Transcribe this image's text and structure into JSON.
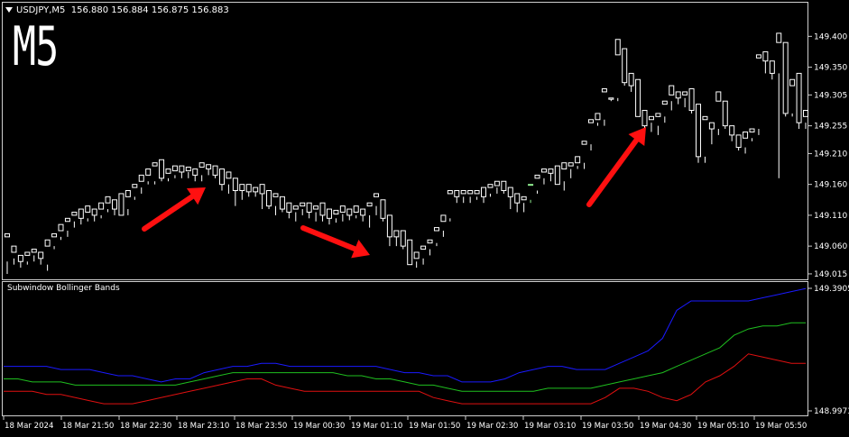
{
  "header": {
    "symbol": "USDJPY,M5",
    "ohlc": "156.880 156.884 156.875 156.883"
  },
  "timeframe_label": "M5",
  "subwindow": {
    "title": "Subwindow Bollinger Bands",
    "scale_top": "149.3905",
    "scale_bottom": "148.9973"
  },
  "colors": {
    "bull": "#90ee90",
    "bear": "#ffffff",
    "upper": "#1a1aff",
    "middle": "#1fbf1f",
    "lower": "#e01010",
    "arrow": "#ff1010"
  },
  "chart_data": [
    {
      "type": "candlestick",
      "series": "USDJPY M5",
      "yticks": [
        "149.400",
        "149.350",
        "149.305",
        "149.255",
        "149.210",
        "149.160",
        "149.110",
        "149.060",
        "149.015"
      ],
      "ylim": [
        149.012,
        149.418
      ],
      "xticks": [
        "18 Mar 2024",
        "18 Mar 21:50",
        "18 Mar 22:30",
        "18 Mar 23:10",
        "18 Mar 23:50",
        "19 Mar 00:30",
        "19 Mar 01:10",
        "19 Mar 01:50",
        "19 Mar 02:30",
        "19 Mar 03:10",
        "19 Mar 03:50",
        "19 Mar 04:30",
        "19 Mar 05:10",
        "19 Mar 05:50"
      ],
      "candles": [
        [
          149.08,
          149.015,
          149.035,
          149.075
        ],
        [
          149.06,
          149.03,
          149.04,
          149.05
        ],
        [
          149.045,
          149.025,
          149.04,
          149.035
        ],
        [
          149.05,
          149.03,
          149.035,
          149.045
        ],
        [
          149.055,
          149.035,
          149.045,
          149.05
        ],
        [
          149.05,
          149.03,
          149.045,
          149.04
        ],
        [
          149.07,
          149.02,
          149.03,
          149.06
        ],
        [
          149.08,
          149.055,
          149.06,
          149.075
        ],
        [
          149.095,
          149.07,
          149.075,
          149.085
        ],
        [
          149.105,
          149.075,
          149.085,
          149.1
        ],
        [
          149.115,
          149.09,
          149.1,
          149.11
        ],
        [
          149.12,
          149.095,
          149.11,
          149.105
        ],
        [
          149.125,
          149.1,
          149.105,
          149.115
        ],
        [
          149.12,
          149.1,
          149.115,
          149.11
        ],
        [
          149.13,
          149.105,
          149.11,
          149.12
        ],
        [
          149.14,
          149.115,
          149.12,
          149.13
        ],
        [
          149.135,
          149.11,
          149.13,
          149.12
        ],
        [
          149.145,
          149.115,
          149.12,
          149.11
        ],
        [
          149.15,
          149.12,
          149.11,
          149.14
        ],
        [
          149.16,
          149.135,
          149.14,
          149.155
        ],
        [
          149.175,
          149.145,
          149.155,
          149.165
        ],
        [
          149.185,
          149.16,
          149.165,
          149.175
        ],
        [
          149.195,
          149.16,
          149.165,
          149.19
        ],
        [
          149.2,
          149.165,
          149.19,
          149.17
        ],
        [
          149.185,
          149.165,
          149.17,
          149.178
        ],
        [
          149.19,
          149.17,
          149.175,
          149.182
        ],
        [
          149.19,
          149.17,
          149.182,
          149.18
        ],
        [
          149.188,
          149.17,
          149.18,
          149.182
        ],
        [
          149.185,
          149.165,
          149.182,
          149.175
        ],
        [
          149.195,
          149.165,
          149.175,
          149.188
        ],
        [
          149.192,
          149.175,
          149.188,
          149.185
        ],
        [
          149.19,
          149.17,
          149.185,
          149.175
        ],
        [
          149.185,
          149.15,
          149.175,
          149.16
        ],
        [
          149.18,
          149.145,
          149.16,
          149.17
        ],
        [
          149.17,
          149.125,
          149.17,
          149.15
        ],
        [
          149.16,
          149.135,
          149.15,
          149.15
        ],
        [
          149.16,
          149.14,
          149.15,
          149.148
        ],
        [
          149.155,
          149.14,
          149.15,
          149.148
        ],
        [
          149.16,
          149.12,
          149.148,
          149.145
        ],
        [
          149.15,
          149.12,
          149.145,
          149.125
        ],
        [
          149.145,
          149.11,
          149.125,
          149.14
        ],
        [
          149.14,
          149.115,
          149.135,
          149.12
        ],
        [
          149.13,
          149.105,
          149.12,
          149.115
        ],
        [
          149.125,
          149.1,
          149.115,
          149.12
        ],
        [
          149.13,
          149.11,
          149.12,
          149.125
        ],
        [
          149.13,
          149.105,
          149.125,
          149.115
        ],
        [
          149.125,
          149.1,
          149.115,
          149.12
        ],
        [
          149.13,
          149.1,
          149.12,
          149.11
        ],
        [
          149.12,
          149.095,
          149.11,
          149.105
        ],
        [
          149.118,
          149.098,
          149.105,
          149.112
        ],
        [
          149.125,
          149.1,
          149.112,
          149.115
        ],
        [
          149.12,
          149.102,
          149.115,
          149.11
        ],
        [
          149.125,
          149.105,
          149.11,
          149.115
        ],
        [
          149.12,
          149.1,
          149.115,
          149.11
        ],
        [
          149.13,
          149.09,
          149.11,
          149.125
        ],
        [
          149.145,
          149.11,
          149.125,
          149.14
        ],
        [
          149.135,
          149.1,
          149.135,
          149.105
        ],
        [
          149.11,
          149.06,
          149.105,
          149.075
        ],
        [
          149.085,
          149.06,
          149.075,
          149.075
        ],
        [
          149.085,
          149.055,
          149.08,
          149.06
        ],
        [
          149.07,
          149.03,
          149.065,
          149.03
        ],
        [
          149.05,
          149.025,
          149.035,
          149.04
        ],
        [
          149.06,
          149.03,
          149.04,
          149.055
        ],
        [
          149.07,
          149.045,
          149.055,
          149.065
        ],
        [
          149.09,
          149.06,
          149.065,
          149.085
        ],
        [
          149.11,
          149.075,
          149.085,
          149.1
        ],
        [
          149.15,
          149.1,
          149.105,
          149.145
        ],
        [
          149.15,
          149.13,
          149.145,
          149.14
        ],
        [
          149.15,
          149.13,
          149.14,
          149.145
        ],
        [
          149.15,
          149.13,
          149.14,
          149.145
        ],
        [
          149.15,
          149.135,
          149.14,
          149.145
        ],
        [
          149.155,
          149.13,
          149.145,
          149.14
        ],
        [
          149.16,
          149.14,
          149.145,
          149.155
        ],
        [
          149.165,
          149.145,
          149.155,
          149.158
        ],
        [
          149.165,
          149.145,
          149.158,
          149.15
        ],
        [
          149.155,
          149.12,
          149.15,
          149.14
        ],
        [
          149.145,
          149.115,
          149.14,
          149.13
        ],
        [
          149.14,
          149.115,
          149.13,
          149.135
        ],
        [
          149.16,
          149.13,
          149.135,
          149.16
        ],
        [
          149.175,
          149.145,
          149.15,
          149.17
        ],
        [
          149.185,
          149.16,
          149.17,
          149.18
        ],
        [
          149.185,
          149.165,
          149.18,
          149.178
        ],
        [
          149.19,
          149.165,
          149.178,
          149.16
        ],
        [
          149.195,
          149.15,
          149.165,
          149.185
        ],
        [
          149.195,
          149.17,
          149.185,
          149.19
        ],
        [
          149.205,
          149.185,
          149.19,
          149.195
        ],
        [
          149.23,
          149.185,
          149.195,
          149.225
        ],
        [
          149.265,
          149.215,
          149.225,
          149.26
        ],
        [
          149.275,
          149.255,
          149.26,
          149.265
        ],
        [
          149.315,
          149.255,
          149.265,
          149.31
        ],
        [
          149.3,
          149.295,
          149.3,
          149.298
        ],
        [
          149.395,
          149.295,
          149.3,
          149.37
        ],
        [
          149.38,
          149.32,
          149.375,
          149.325
        ],
        [
          149.34,
          149.31,
          149.325,
          149.32
        ],
        [
          149.33,
          149.275,
          149.32,
          149.27
        ],
        [
          149.28,
          149.25,
          149.265,
          149.255
        ],
        [
          149.27,
          149.245,
          149.26,
          149.265
        ],
        [
          149.275,
          149.24,
          149.255,
          149.27
        ],
        [
          149.295,
          149.26,
          149.27,
          149.29
        ],
        [
          149.32,
          149.28,
          149.295,
          149.305
        ],
        [
          149.31,
          149.29,
          149.305,
          149.3
        ],
        [
          149.31,
          149.285,
          149.3,
          149.305
        ],
        [
          149.315,
          149.275,
          149.305,
          149.28
        ],
        [
          149.29,
          149.195,
          149.28,
          149.205
        ],
        [
          149.27,
          149.195,
          149.205,
          149.265
        ],
        [
          149.26,
          149.225,
          149.26,
          149.25
        ],
        [
          149.31,
          149.24,
          149.25,
          149.295
        ],
        [
          149.295,
          149.25,
          149.29,
          149.255
        ],
        [
          149.255,
          149.23,
          149.255,
          149.24
        ],
        [
          149.24,
          149.215,
          149.23,
          149.22
        ],
        [
          149.245,
          149.21,
          149.22,
          149.235
        ],
        [
          149.25,
          149.23,
          149.235,
          149.245
        ],
        [
          149.37,
          149.24,
          149.25,
          149.365
        ],
        [
          149.375,
          149.34,
          149.365,
          149.36
        ],
        [
          149.36,
          149.33,
          149.36,
          149.34
        ],
        [
          149.405,
          149.17,
          149.34,
          149.39
        ],
        [
          149.39,
          149.27,
          149.325,
          149.275
        ],
        [
          149.33,
          149.27,
          149.275,
          149.32
        ],
        [
          149.34,
          149.25,
          149.32,
          149.26
        ],
        [
          149.28,
          149.25,
          149.26,
          149.27
        ]
      ]
    },
    {
      "type": "line",
      "series_names": [
        "upper",
        "middle",
        "lower"
      ],
      "ylim": [
        148.9973,
        149.3905
      ],
      "upper": [
        149.14,
        149.14,
        149.14,
        149.14,
        149.13,
        149.13,
        149.13,
        149.12,
        149.11,
        149.11,
        149.1,
        149.09,
        149.1,
        149.1,
        149.12,
        149.13,
        149.14,
        149.14,
        149.15,
        149.15,
        149.14,
        149.14,
        149.14,
        149.14,
        149.14,
        149.14,
        149.14,
        149.13,
        149.12,
        149.12,
        149.11,
        149.11,
        149.09,
        149.09,
        149.09,
        149.1,
        149.12,
        149.13,
        149.14,
        149.14,
        149.13,
        149.13,
        149.13,
        149.15,
        149.17,
        149.19,
        149.23,
        149.32,
        149.35,
        149.35,
        149.35,
        149.35,
        149.35,
        149.36,
        149.37,
        149.38,
        149.39
      ],
      "middle": [
        149.1,
        149.1,
        149.09,
        149.09,
        149.09,
        149.08,
        149.08,
        149.08,
        149.08,
        149.08,
        149.08,
        149.08,
        149.08,
        149.09,
        149.1,
        149.11,
        149.12,
        149.12,
        149.12,
        149.12,
        149.12,
        149.12,
        149.12,
        149.12,
        149.11,
        149.11,
        149.1,
        149.1,
        149.09,
        149.08,
        149.08,
        149.07,
        149.06,
        149.06,
        149.06,
        149.06,
        149.06,
        149.06,
        149.07,
        149.07,
        149.07,
        149.07,
        149.08,
        149.09,
        149.1,
        149.11,
        149.12,
        149.14,
        149.16,
        149.18,
        149.2,
        149.24,
        149.26,
        149.27,
        149.27,
        149.28,
        149.28
      ],
      "lower": [
        149.06,
        149.06,
        149.06,
        149.05,
        149.05,
        149.04,
        149.03,
        149.02,
        149.02,
        149.02,
        149.03,
        149.04,
        149.05,
        149.06,
        149.07,
        149.08,
        149.09,
        149.1,
        149.1,
        149.08,
        149.07,
        149.06,
        149.06,
        149.06,
        149.06,
        149.06,
        149.06,
        149.06,
        149.06,
        149.06,
        149.04,
        149.03,
        149.02,
        149.02,
        149.02,
        149.02,
        149.02,
        149.02,
        149.02,
        149.02,
        149.02,
        149.02,
        149.04,
        149.07,
        149.07,
        149.06,
        149.04,
        149.03,
        149.05,
        149.09,
        149.11,
        149.14,
        149.18,
        149.17,
        149.16,
        149.15,
        149.15
      ]
    }
  ]
}
